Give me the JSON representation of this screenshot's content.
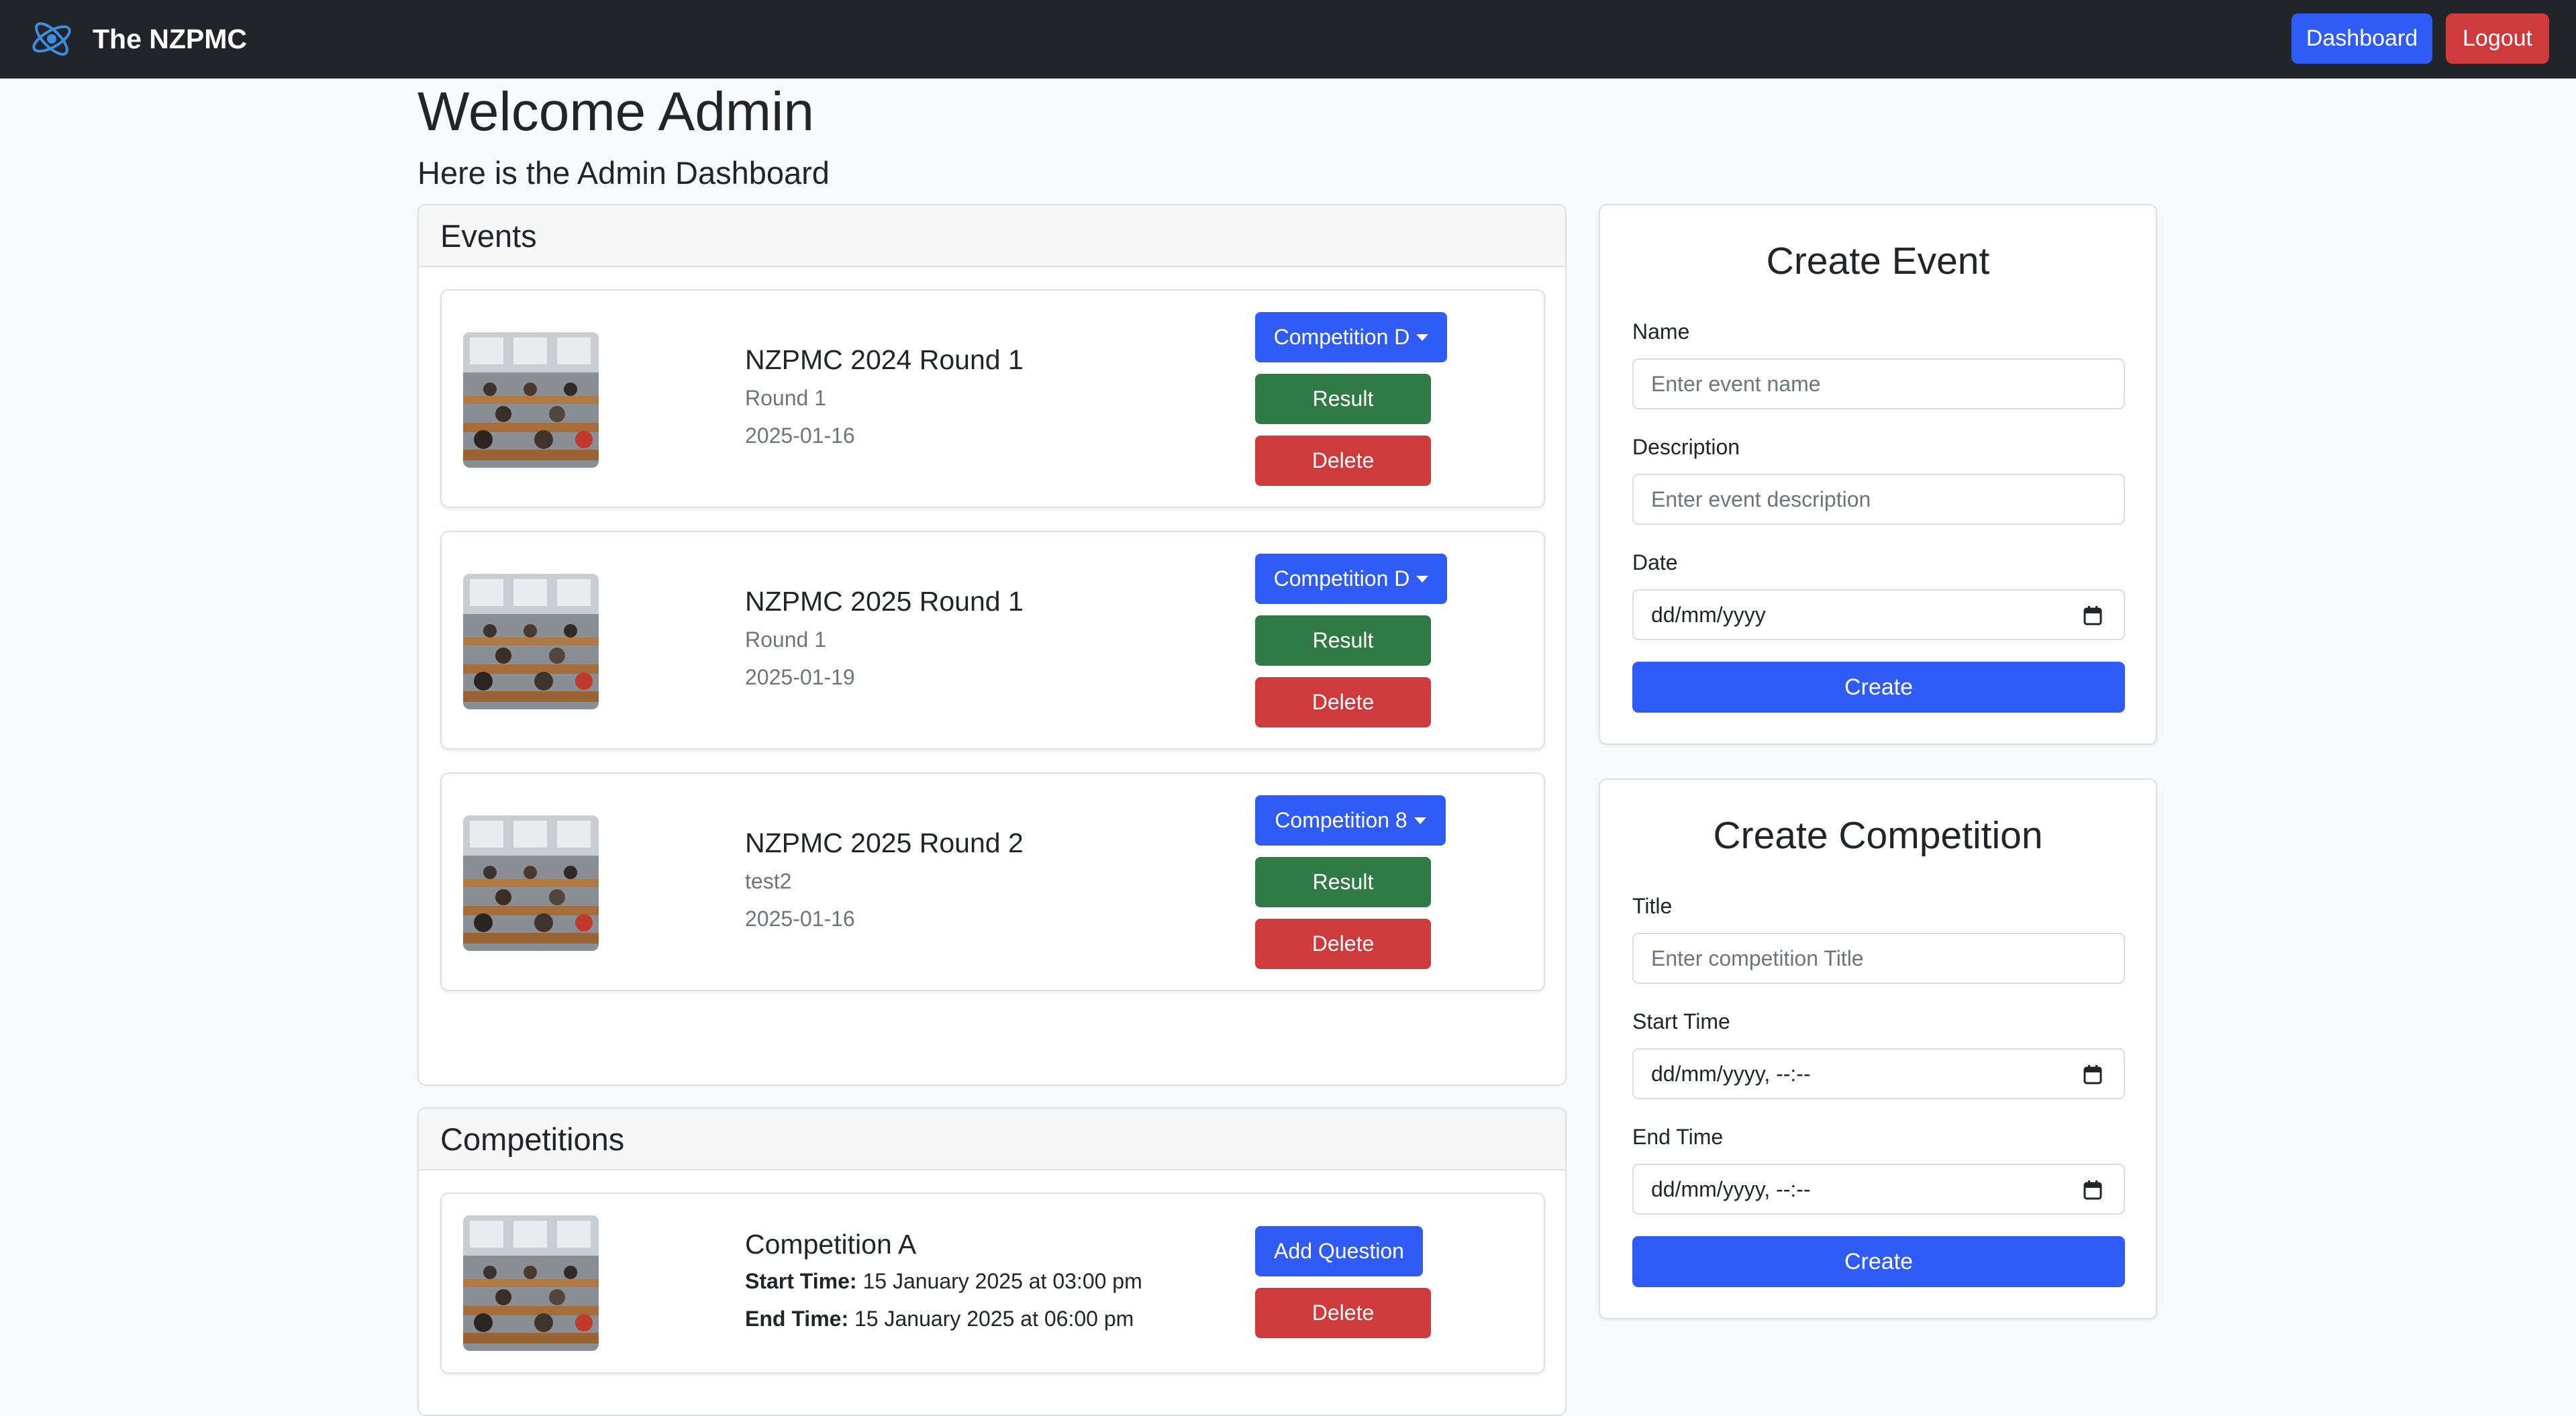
{
  "navbar": {
    "brand": "The NZPMC",
    "dashboard_label": "Dashboard",
    "logout_label": "Logout"
  },
  "header": {
    "welcome": "Welcome Admin",
    "subtitle": "Here is the Admin Dashboard"
  },
  "events": {
    "heading": "Events",
    "items": [
      {
        "title": "NZPMC 2024 Round 1",
        "subtitle": "Round 1",
        "date": "2025-01-16",
        "competition_label": "Competition D",
        "result_label": "Result",
        "delete_label": "Delete"
      },
      {
        "title": "NZPMC 2025 Round 1",
        "subtitle": "Round 1",
        "date": "2025-01-19",
        "competition_label": "Competition D",
        "result_label": "Result",
        "delete_label": "Delete"
      },
      {
        "title": "NZPMC 2025 Round 2",
        "subtitle": "test2",
        "date": "2025-01-16",
        "competition_label": "Competition 8",
        "result_label": "Result",
        "delete_label": "Delete"
      }
    ]
  },
  "competitions": {
    "heading": "Competitions",
    "items": [
      {
        "title": "Competition A",
        "start_label": "Start Time:",
        "start_value": "15 January 2025 at 03:00 pm",
        "end_label": "End Time:",
        "end_value": "15 January 2025 at 06:00 pm",
        "add_question_label": "Add Question",
        "delete_label": "Delete"
      }
    ]
  },
  "create_event": {
    "title": "Create Event",
    "name_label": "Name",
    "name_placeholder": "Enter event name",
    "description_label": "Description",
    "description_placeholder": "Enter event description",
    "date_label": "Date",
    "date_value": "dd/mm/yyyy",
    "submit_label": "Create"
  },
  "create_competition": {
    "title": "Create Competition",
    "title_label": "Title",
    "title_placeholder": "Enter competition Title",
    "start_label": "Start Time",
    "start_value": "dd/mm/yyyy, --:--",
    "end_label": "End Time",
    "end_value": "dd/mm/yyyy, --:--",
    "submit_label": "Create"
  },
  "colors": {
    "navbar": "#212529",
    "primary": "#2f5cf6",
    "success": "#2f7a45",
    "danger": "#cf3a3c"
  }
}
